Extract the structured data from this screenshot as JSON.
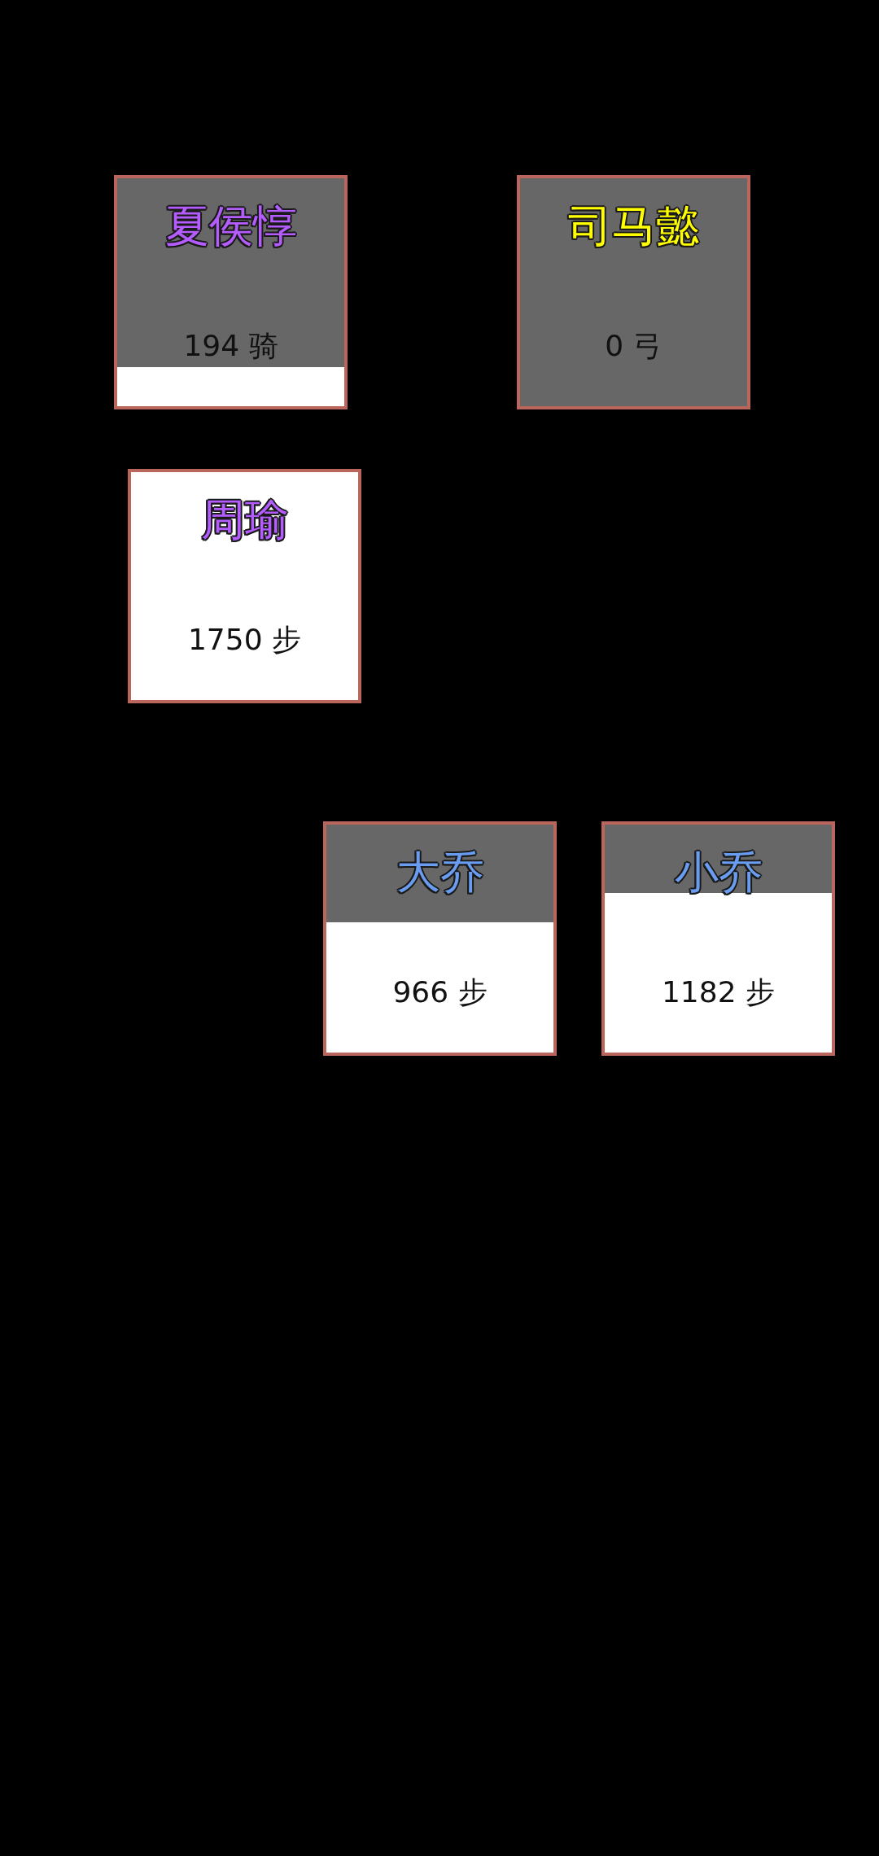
{
  "rows": [
    {
      "cards": [
        {
          "name": "夏侯惇",
          "color": "#b55cff",
          "count": "194 骑",
          "level": 0.83
        },
        {
          "name": "司马懿",
          "color": "#ffff00",
          "count": "0 弓",
          "level": 1
        }
      ]
    },
    {
      "cards": [
        {
          "name": "周瑜",
          "color": "#b55cff",
          "count": "1750 步"
        }
      ]
    },
    {
      "cards": [
        {
          "name": "大乔",
          "color": "#6a9cf0",
          "count": "966 步",
          "level": 0.43
        },
        {
          "name": "小乔",
          "color": "#6a9cf0",
          "count": "1182 步",
          "level": 0.3
        }
      ]
    }
  ]
}
